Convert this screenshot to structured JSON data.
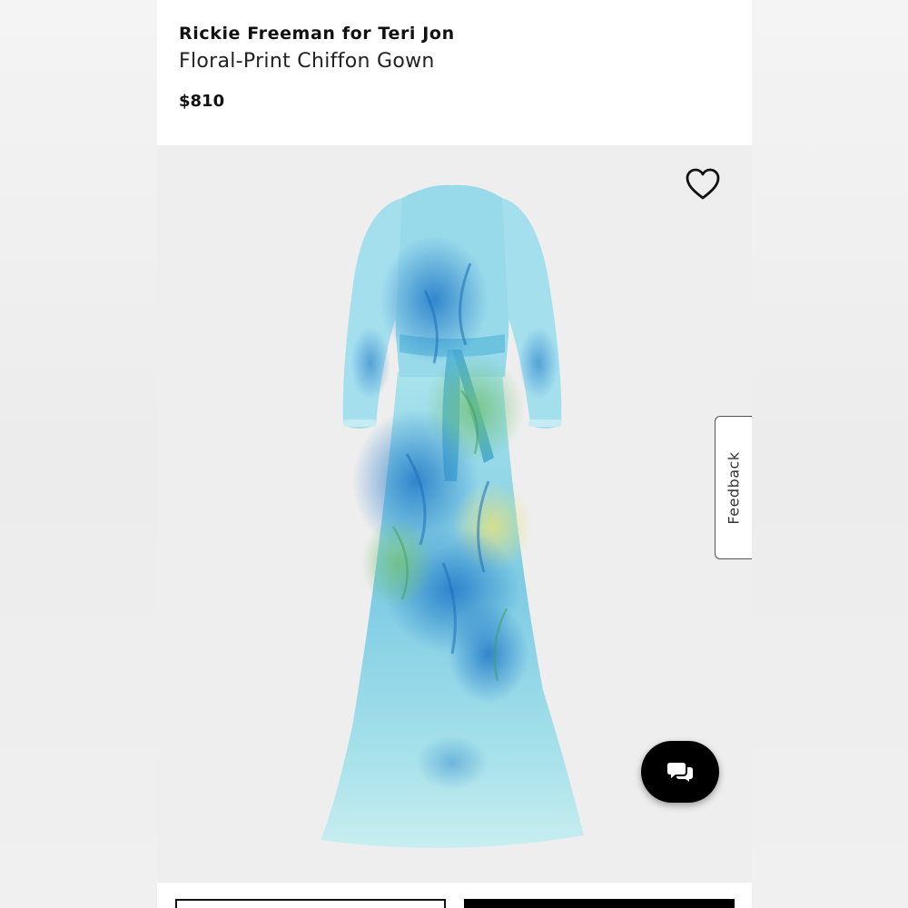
{
  "product": {
    "brand": "Rickie Freeman for Teri Jon",
    "name": "Floral-Print Chiffon Gown",
    "price": "$810"
  },
  "icons": {
    "wishlist": "heart-outline-icon",
    "chat": "chat-bubbles-icon"
  },
  "feedback": {
    "label": "Feedback"
  },
  "colors": {
    "accent": "#000000",
    "image_background": "#eeeeee",
    "gown_primary": "#7fd3e6",
    "gown_secondary": "#2f8fd0"
  }
}
